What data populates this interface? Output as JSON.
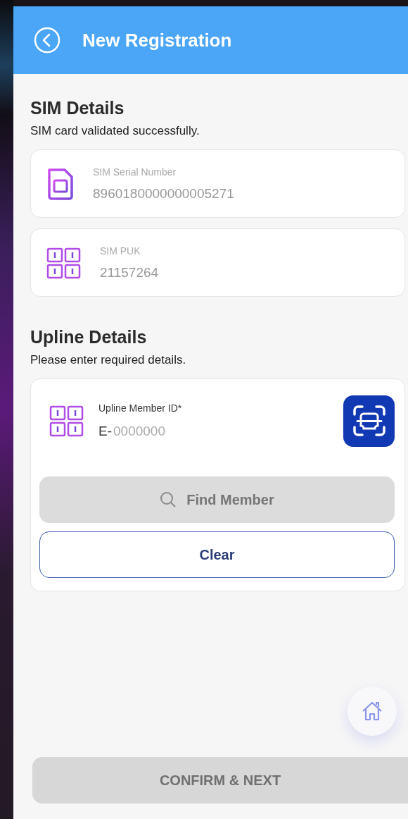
{
  "header": {
    "title": "New Registration"
  },
  "sim_details": {
    "title": "SIM Details",
    "subtitle": "SIM card validated successfully.",
    "fields": [
      {
        "kind": "sim",
        "label": "SIM Serial Number",
        "value": "8960180000000005271"
      },
      {
        "kind": "keypad",
        "label": "SIM PUK",
        "value": "21157264"
      }
    ]
  },
  "upline_details": {
    "title": "Upline Details",
    "subtitle": "Please enter required details.",
    "member_id": {
      "label": "Upline Member ID*",
      "prefix": "E-",
      "placeholder": "0000000"
    },
    "find_button": {
      "label": "Find Member",
      "disabled": true
    },
    "clear_button": {
      "label": "Clear",
      "disabled": false
    }
  },
  "confirm_button": {
    "label": "CONFIRM & NEXT",
    "disabled": true
  }
}
